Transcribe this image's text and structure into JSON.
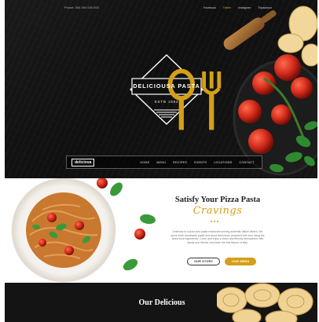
{
  "topbar": {
    "contact": "Phone: 000 000 000 000",
    "social": [
      "Facebook",
      "Twitter",
      "Instagram",
      "Tripadvisor"
    ],
    "active_index": 1
  },
  "logo": {
    "name": "DELICIOUSA PASTA",
    "estb": "ESTB 1982",
    "icon": "fork-spoon-icon"
  },
  "nav": {
    "brand": "deliciosa",
    "items": [
      "HOME",
      "MENU",
      "RECIPES",
      "EVENTS",
      "LOCATIONS",
      "CONTACT"
    ]
  },
  "welcome": {
    "title": "Satisfy Your Pizza Pasta",
    "script": "Cravings",
    "body": "Deliciosa is a pizza and pasta restaurant serving authentic italian dishes. We serve fresh handmade pasta and wood fired pizza, prepared with love using the finest local ingredients. Come and enjoy a warm and friendly atmosphere with family and friends, and taste the real flavors of italy.",
    "buttons": {
      "primary": "OUR STORY",
      "secondary": "OUR MENU"
    }
  },
  "section2": {
    "title": "Our Delicious"
  },
  "colors": {
    "accent": "#d4a017",
    "dark": "#141414",
    "tomato": "#c8231a",
    "basil": "#2f8a2f"
  }
}
